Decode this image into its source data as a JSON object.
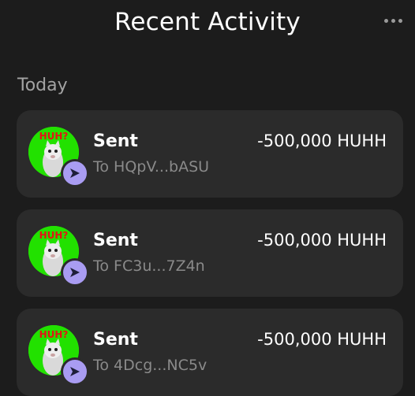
{
  "header": {
    "title": "Recent Activity",
    "menu_icon": "more-horizontal-icon"
  },
  "section_label": "Today",
  "activities": [
    {
      "label": "Sent",
      "subtitle": "To HQpV...bASU",
      "amount": "-500,000 HUHH",
      "token_image_text": "HUH?",
      "badge_icon": "send-arrow-icon"
    },
    {
      "label": "Sent",
      "subtitle": "To FC3u...7Z4n",
      "amount": "-500,000 HUHH",
      "token_image_text": "HUH?",
      "badge_icon": "send-arrow-icon"
    },
    {
      "label": "Sent",
      "subtitle": "To 4Dcg...NC5v",
      "amount": "-500,000 HUHH",
      "token_image_text": "HUH?",
      "badge_icon": "send-arrow-icon"
    }
  ],
  "colors": {
    "background": "#1c1c1c",
    "card": "#2b2b2b",
    "token_bg": "#22e100",
    "badge": "#a99cf2",
    "muted_text": "#8a8a8a"
  }
}
